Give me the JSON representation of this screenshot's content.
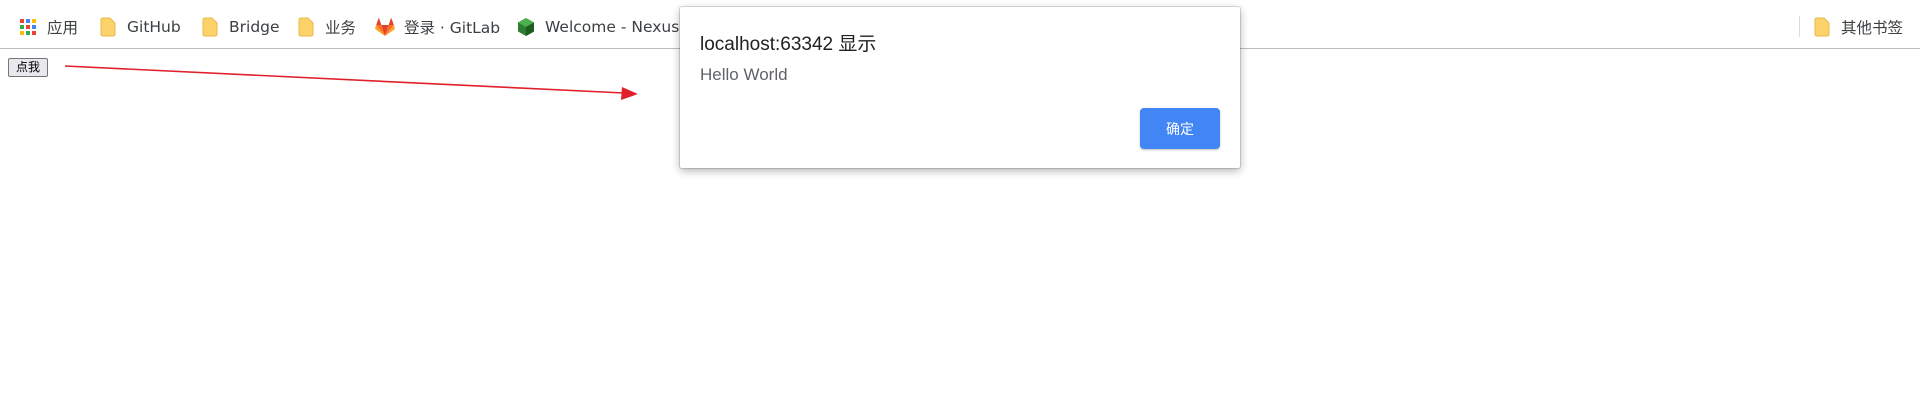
{
  "bookmarks": {
    "apps_label": "应用",
    "items": [
      {
        "label": "GitHub",
        "icon": "folder-icon"
      },
      {
        "label": "Bridge",
        "icon": "folder-icon"
      },
      {
        "label": "业务",
        "icon": "folder-icon"
      },
      {
        "label": "登录 · GitLab",
        "icon": "gitlab-icon"
      },
      {
        "label": "Welcome - Nexus",
        "icon": "nexus-icon"
      }
    ],
    "other_label": "其他书签"
  },
  "page": {
    "button_label": "点我"
  },
  "annotation": {
    "arrow_color": "#e0212b"
  },
  "dialog": {
    "title": "localhost:63342 显示",
    "message": "Hello World",
    "ok_label": "确定",
    "ok_color": "#4285f4"
  }
}
